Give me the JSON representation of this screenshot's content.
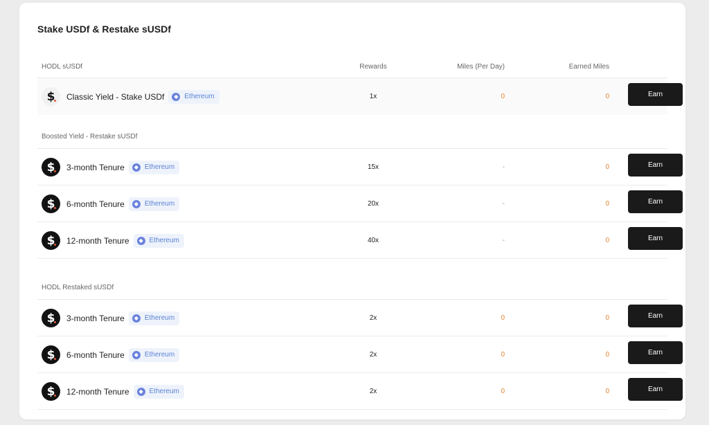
{
  "title": "Stake USDf & Restake sUSDf",
  "columns": {
    "name": "HODL sUSDf",
    "rewards": "Rewards",
    "miles": "Miles (Per Day)",
    "earned": "Earned Miles"
  },
  "network_icon": "ethereum-icon",
  "button_label": "Earn",
  "colors": {
    "accent_orange": "#e38431",
    "button_bg": "#1a1a1a",
    "chip_text": "#5b82d4"
  },
  "classic": {
    "name": "Classic Yield - Stake USDf",
    "network": "Ethereum",
    "rewards": "1x",
    "miles": "0",
    "earned": "0"
  },
  "boosted": {
    "label": "Boosted Yield - Restake sUSDf",
    "rows": [
      {
        "name": "3-month Tenure",
        "network": "Ethereum",
        "rewards": "15x",
        "miles": "-",
        "earned": "0"
      },
      {
        "name": "6-month Tenure",
        "network": "Ethereum",
        "rewards": "20x",
        "miles": "-",
        "earned": "0"
      },
      {
        "name": "12-month Tenure",
        "network": "Ethereum",
        "rewards": "40x",
        "miles": "-",
        "earned": "0"
      }
    ]
  },
  "hodl_restaked": {
    "label": "HODL Restaked sUSDf",
    "rows": [
      {
        "name": "3-month Tenure",
        "network": "Ethereum",
        "rewards": "2x",
        "miles": "0",
        "earned": "0"
      },
      {
        "name": "6-month Tenure",
        "network": "Ethereum",
        "rewards": "2x",
        "miles": "0",
        "earned": "0"
      },
      {
        "name": "12-month Tenure",
        "network": "Ethereum",
        "rewards": "2x",
        "miles": "0",
        "earned": "0"
      }
    ]
  }
}
